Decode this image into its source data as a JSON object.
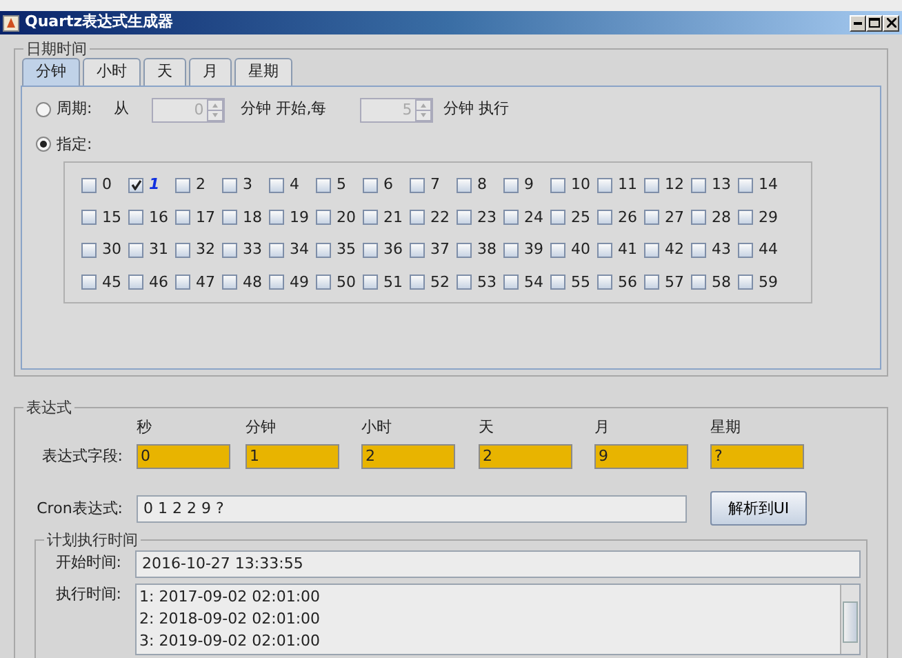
{
  "window": {
    "title": "Quartz表达式生成器"
  },
  "datetime_group": {
    "title": "日期时间",
    "tabs": [
      {
        "label": "分钟",
        "selected": true
      },
      {
        "label": "小时",
        "selected": false
      },
      {
        "label": "天",
        "selected": false
      },
      {
        "label": "月",
        "selected": false
      },
      {
        "label": "星期",
        "selected": false
      }
    ],
    "period": {
      "label": "周期:",
      "selected": false,
      "from_label": "从",
      "start_value": "0",
      "start_label": "分钟 开始,每",
      "interval_value": "5",
      "interval_label": "分钟 执行",
      "disabled": true
    },
    "specific": {
      "label": "指定:",
      "selected": true
    },
    "minutes": [
      {
        "label": "0",
        "checked": false
      },
      {
        "label": "1",
        "checked": true
      },
      {
        "label": "2",
        "checked": false
      },
      {
        "label": "3",
        "checked": false
      },
      {
        "label": "4",
        "checked": false
      },
      {
        "label": "5",
        "checked": false
      },
      {
        "label": "6",
        "checked": false
      },
      {
        "label": "7",
        "checked": false
      },
      {
        "label": "8",
        "checked": false
      },
      {
        "label": "9",
        "checked": false
      },
      {
        "label": "10",
        "checked": false
      },
      {
        "label": "11",
        "checked": false
      },
      {
        "label": "12",
        "checked": false
      },
      {
        "label": "13",
        "checked": false
      },
      {
        "label": "14",
        "checked": false
      },
      {
        "label": "15",
        "checked": false
      },
      {
        "label": "16",
        "checked": false
      },
      {
        "label": "17",
        "checked": false
      },
      {
        "label": "18",
        "checked": false
      },
      {
        "label": "19",
        "checked": false
      },
      {
        "label": "20",
        "checked": false
      },
      {
        "label": "21",
        "checked": false
      },
      {
        "label": "22",
        "checked": false
      },
      {
        "label": "23",
        "checked": false
      },
      {
        "label": "24",
        "checked": false
      },
      {
        "label": "25",
        "checked": false
      },
      {
        "label": "26",
        "checked": false
      },
      {
        "label": "27",
        "checked": false
      },
      {
        "label": "28",
        "checked": false
      },
      {
        "label": "29",
        "checked": false
      },
      {
        "label": "30",
        "checked": false
      },
      {
        "label": "31",
        "checked": false
      },
      {
        "label": "32",
        "checked": false
      },
      {
        "label": "33",
        "checked": false
      },
      {
        "label": "34",
        "checked": false
      },
      {
        "label": "35",
        "checked": false
      },
      {
        "label": "36",
        "checked": false
      },
      {
        "label": "37",
        "checked": false
      },
      {
        "label": "38",
        "checked": false
      },
      {
        "label": "39",
        "checked": false
      },
      {
        "label": "40",
        "checked": false
      },
      {
        "label": "41",
        "checked": false
      },
      {
        "label": "42",
        "checked": false
      },
      {
        "label": "43",
        "checked": false
      },
      {
        "label": "44",
        "checked": false
      },
      {
        "label": "45",
        "checked": false
      },
      {
        "label": "46",
        "checked": false
      },
      {
        "label": "47",
        "checked": false
      },
      {
        "label": "48",
        "checked": false
      },
      {
        "label": "49",
        "checked": false
      },
      {
        "label": "50",
        "checked": false
      },
      {
        "label": "51",
        "checked": false
      },
      {
        "label": "52",
        "checked": false
      },
      {
        "label": "53",
        "checked": false
      },
      {
        "label": "54",
        "checked": false
      },
      {
        "label": "55",
        "checked": false
      },
      {
        "label": "56",
        "checked": false
      },
      {
        "label": "57",
        "checked": false
      },
      {
        "label": "58",
        "checked": false
      },
      {
        "label": "59",
        "checked": false
      }
    ]
  },
  "expression_group": {
    "title": "表达式",
    "columns": [
      "秒",
      "分钟",
      "小时",
      "天",
      "月",
      "星期"
    ],
    "fields_label": "表达式字段:",
    "fields": [
      "0",
      "1",
      "2",
      "2",
      "9",
      "?"
    ],
    "cron_label": "Cron表达式:",
    "cron_value": "0 1 2 2 9 ?",
    "parse_button": "解析到UI",
    "schedule": {
      "title": "计划执行时间",
      "start_label": "开始时间:",
      "start_value": "2016-10-27 13:33:55",
      "runs_label": "执行时间:",
      "runs": [
        "1: 2017-09-02 02:01:00",
        "2: 2018-09-02 02:01:00",
        "3: 2019-09-02 02:01:00"
      ]
    }
  }
}
